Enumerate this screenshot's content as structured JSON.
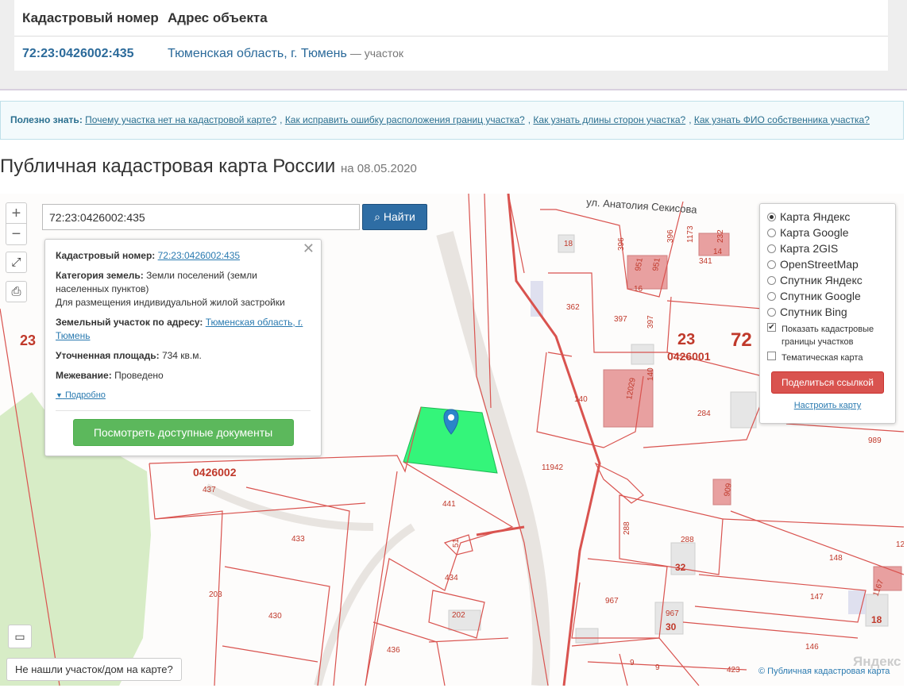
{
  "result": {
    "headers": [
      "Кадастровый номер",
      "Адрес объекта"
    ],
    "row": {
      "cadastral": "72:23:0426002:435",
      "address": "Тюменская область, г. Тюмень",
      "kind": "— участок"
    }
  },
  "info": {
    "label": "Полезно знать:",
    "links": [
      "Почему участка нет на кадастровой карте?",
      "Как исправить ошибку расположения границ участка?",
      "Как узнать длины сторон участка?",
      "Как узнать ФИО собственника участка?"
    ]
  },
  "page": {
    "title": "Публичная кадастровая карта России",
    "date": "на 08.05.2020"
  },
  "map": {
    "zoom_in": "+",
    "zoom_out": "−",
    "search_value": "72:23:0426002:435",
    "search_button": "Найти",
    "street": "ул. Анатолия Секисова",
    "not_found": "Не нашли участок/дом на карте?",
    "copyright": "© Публичная кадастровая карта",
    "logo": "Яндекс",
    "labels": [
      "18",
      "396",
      "396",
      "1173",
      "232",
      "341",
      "14",
      "951",
      "951",
      "16",
      "362",
      "397",
      "397",
      "23",
      "72",
      "0426001",
      "140",
      "140",
      "12029",
      "284",
      "989",
      "11942",
      "909",
      "23",
      "0426002",
      "437",
      "441",
      "433",
      "51",
      "288",
      "288",
      "32",
      "12",
      "148",
      "203",
      "430",
      "434",
      "967",
      "967",
      "30",
      "147",
      "202",
      "436",
      "146",
      "18",
      "9",
      "9",
      "423",
      "1167"
    ]
  },
  "popup": {
    "cadastral_label": "Кадастровый номер:",
    "cadastral_value": "72:23:0426002:435",
    "category_label": "Категория земель:",
    "category_value": "Земли поселений (земли населенных пунктов)",
    "usage": "Для размещения индивидуальной жилой застройки",
    "address_label": "Земельный участок по адресу:",
    "address_value": "Тюменская область, г. Тюмень",
    "area_label": "Уточненная площадь:",
    "area_value": "734 кв.м.",
    "survey_label": "Межевание:",
    "survey_value": "Проведено",
    "more": "Подробно",
    "docs_button": "Посмотреть доступные документы",
    "close": "✕"
  },
  "layers": {
    "options": [
      "Карта Яндекс",
      "Карта Google",
      "Карта 2GIS",
      "OpenStreetMap",
      "Спутник Яндекс",
      "Спутник Google",
      "Спутник Bing"
    ],
    "selected": "Карта Яндекс",
    "show_borders": "Показать кадастровые границы участков",
    "thematic": "Тематическая карта",
    "share": "Поделиться ссылкой",
    "setup": "Настроить карту"
  },
  "colors": {
    "parcel_line": "#d9534f",
    "selected_parcel": "#34f57a",
    "building": "#e8a0a0",
    "forest": "#d7ecc6",
    "primary": "#2e6da4",
    "success": "#5cb85c",
    "danger": "#d9534f"
  }
}
